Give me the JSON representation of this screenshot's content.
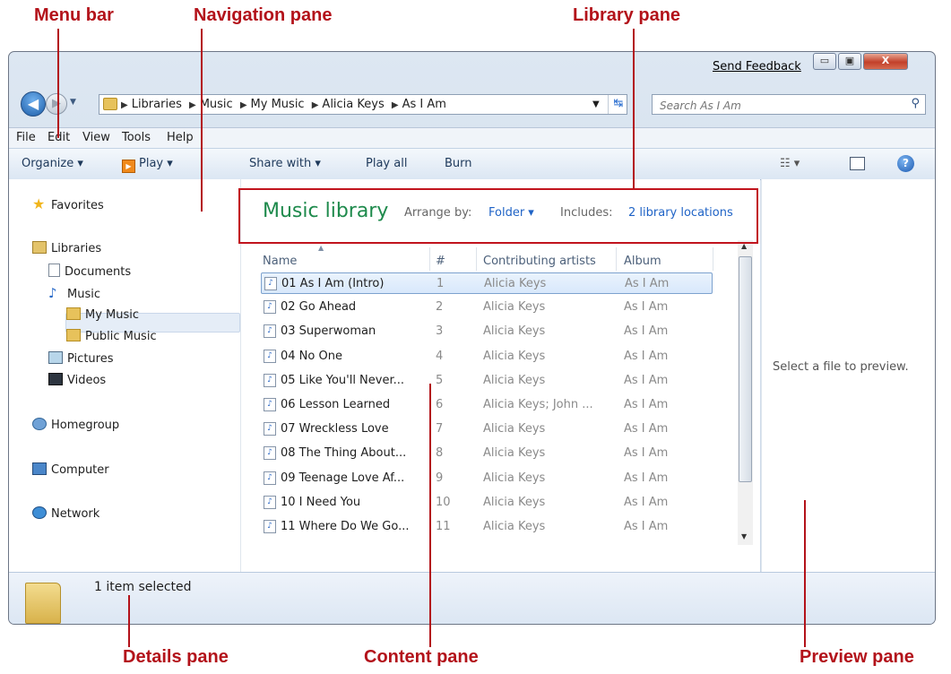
{
  "callouts": {
    "menu_bar": "Menu bar",
    "navigation_pane": "Navigation pane",
    "library_pane": "Library pane",
    "details_pane": "Details pane",
    "content_pane": "Content pane",
    "preview_pane": "Preview pane"
  },
  "titlebar": {
    "send_feedback": "Send Feedback",
    "minimize": "▭",
    "maximize": "▣",
    "close": "X"
  },
  "address": {
    "crumbs": [
      "Libraries",
      "Music",
      "My Music",
      "Alicia Keys",
      "As I Am"
    ],
    "search_placeholder": "Search As I Am"
  },
  "menu": [
    "File",
    "Edit",
    "View",
    "Tools",
    "Help"
  ],
  "toolbar": {
    "organize": "Organize ▾",
    "play": "Play ▾",
    "share_with": "Share with ▾",
    "play_all": "Play all",
    "burn": "Burn"
  },
  "nav": {
    "favorites": "Favorites",
    "libraries": "Libraries",
    "documents": "Documents",
    "music": "Music",
    "my_music": "My Music",
    "public_music": "Public Music",
    "pictures": "Pictures",
    "videos": "Videos",
    "homegroup": "Homegroup",
    "computer": "Computer",
    "network": "Network"
  },
  "library": {
    "title": "Music library",
    "arrange_by_label": "Arrange by:",
    "arrange_by_value": "Folder ▾",
    "includes_label": "Includes:",
    "includes_value": "2 library locations"
  },
  "columns": {
    "name": "Name",
    "num": "#",
    "artists": "Contributing artists",
    "album": "Album"
  },
  "files": [
    {
      "title": "01 As I Am (Intro)",
      "num": "1",
      "artist": "Alicia Keys",
      "album": "As I Am"
    },
    {
      "title": "02 Go Ahead",
      "num": "2",
      "artist": "Alicia Keys",
      "album": "As I Am"
    },
    {
      "title": "03 Superwoman",
      "num": "3",
      "artist": "Alicia Keys",
      "album": "As I Am"
    },
    {
      "title": "04 No One",
      "num": "4",
      "artist": "Alicia Keys",
      "album": "As I Am"
    },
    {
      "title": "05 Like You'll Never...",
      "num": "5",
      "artist": "Alicia Keys",
      "album": "As I Am"
    },
    {
      "title": "06 Lesson Learned",
      "num": "6",
      "artist": "Alicia Keys; John ...",
      "album": "As I Am"
    },
    {
      "title": "07 Wreckless Love",
      "num": "7",
      "artist": "Alicia Keys",
      "album": "As I Am"
    },
    {
      "title": "08 The Thing About...",
      "num": "8",
      "artist": "Alicia Keys",
      "album": "As I Am"
    },
    {
      "title": "09 Teenage Love Af...",
      "num": "9",
      "artist": "Alicia Keys",
      "album": "As I Am"
    },
    {
      "title": "10 I Need You",
      "num": "10",
      "artist": "Alicia Keys",
      "album": "As I Am"
    },
    {
      "title": "11 Where Do We Go...",
      "num": "11",
      "artist": "Alicia Keys",
      "album": "As I Am"
    }
  ],
  "selected_index": 0,
  "preview": {
    "text": "Select a file to preview."
  },
  "details": {
    "status": "1 item selected"
  },
  "colors": {
    "callout_red": "#b3121a",
    "library_title_green": "#1e8a4c",
    "link_blue": "#1f63c6"
  }
}
